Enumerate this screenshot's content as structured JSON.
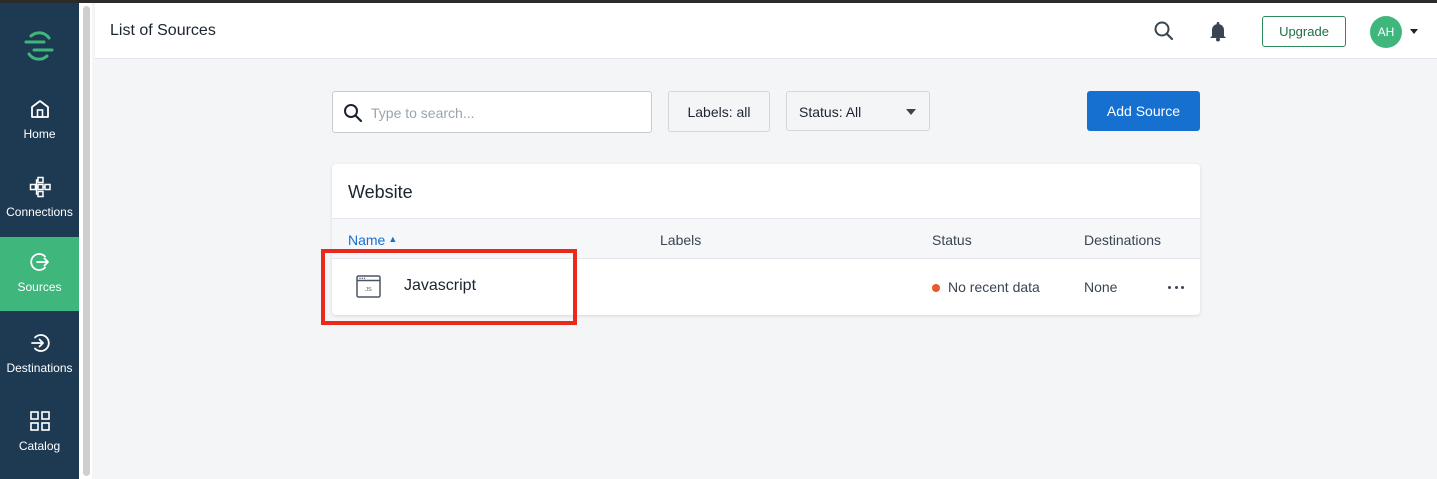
{
  "header": {
    "title": "List of Sources",
    "upgrade_label": "Upgrade",
    "avatar_initials": "AH"
  },
  "sidebar": {
    "items": [
      {
        "label": "Home",
        "icon": "home-icon"
      },
      {
        "label": "Connections",
        "icon": "connections-icon"
      },
      {
        "label": "Sources",
        "icon": "sources-icon",
        "active": true
      },
      {
        "label": "Destinations",
        "icon": "destinations-icon"
      },
      {
        "label": "Catalog",
        "icon": "catalog-icon"
      }
    ]
  },
  "toolbar": {
    "search_placeholder": "Type to search...",
    "labels_filter": "Labels: all",
    "status_filter": "Status: All",
    "add_source_label": "Add Source"
  },
  "card": {
    "title": "Website",
    "columns": {
      "name": "Name",
      "labels": "Labels",
      "status": "Status",
      "destinations": "Destinations"
    },
    "rows": [
      {
        "name": "Javascript",
        "icon_text": "JS",
        "labels": "",
        "status": "No recent data",
        "destinations": "None"
      }
    ]
  },
  "colors": {
    "sidebar": "#1e3a52",
    "active": "#3eb67c",
    "primary": "#1570d0",
    "status_dot": "#e8582a",
    "highlight": "#e8291c"
  }
}
